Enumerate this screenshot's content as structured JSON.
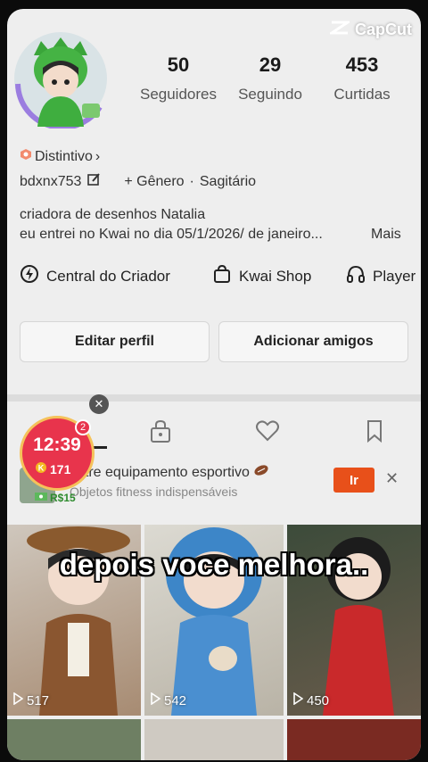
{
  "watermark": {
    "label": "CapCut"
  },
  "stats": [
    {
      "value": "50",
      "label": "Seguidores"
    },
    {
      "value": "29",
      "label": "Seguindo"
    },
    {
      "value": "453",
      "label": "Curtidas"
    }
  ],
  "profile": {
    "badge": "Distintivo",
    "badge_arrow": "›",
    "username": "bdxnx753",
    "gender": "+ Gênero",
    "separator": "·",
    "sign": "Sagitário",
    "bio_line1": "criadora de desenhos Natalia",
    "bio_line2": "eu entrei no Kwai no dia 05/1/2026/ de janeiro...",
    "more": "Mais"
  },
  "links": [
    {
      "label": "Central do Criador",
      "icon": "bolt-circle-icon"
    },
    {
      "label": "Kwai Shop",
      "icon": "bag-icon"
    },
    {
      "label": "Player",
      "icon": "headphones-icon"
    }
  ],
  "buttons": {
    "edit": "Editar perfil",
    "add": "Adicionar amigos"
  },
  "timer": {
    "time": "12:39",
    "coins": "171",
    "badge": "2",
    "reward": "R$15"
  },
  "ad": {
    "title": "ostre equipamento esportivo",
    "subtitle": "Objetos fitness indispensáveis",
    "cta": "Ir",
    "close": "✕"
  },
  "videos": [
    {
      "count": "517"
    },
    {
      "count": "542"
    },
    {
      "count": "450"
    }
  ],
  "caption": "depois voce melhora..",
  "colors": {
    "accent": "#e8501a",
    "timer": "#e8344c"
  }
}
